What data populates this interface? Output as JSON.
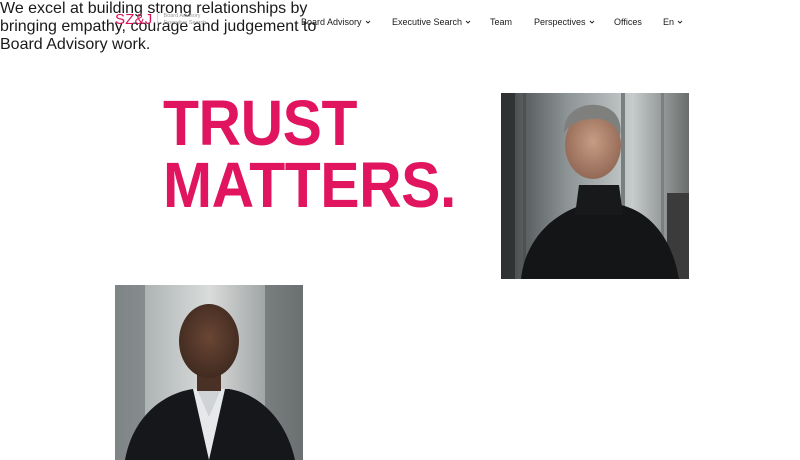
{
  "brand": {
    "logo_text": "SZ&J",
    "sub_line_1": "Board Advisory",
    "sub_line_2": "Executive Search",
    "accent_color": "#e0145f"
  },
  "nav": {
    "items": [
      {
        "label": "Board Advisory",
        "has_dropdown": true
      },
      {
        "label": "Executive Search",
        "has_dropdown": true
      },
      {
        "label": "Team",
        "has_dropdown": false
      },
      {
        "label": "Perspectives",
        "has_dropdown": true
      },
      {
        "label": "Offices",
        "has_dropdown": false
      },
      {
        "label": "En",
        "has_dropdown": true
      }
    ]
  },
  "hero": {
    "headline_line_1": "TRUST",
    "headline_line_2": "MATTERS.",
    "body_line_1": "We excel at building strong relationships by",
    "body_line_2": "bringing empathy, courage and judgement to",
    "body_line_3": "Board Advisory work."
  },
  "images": {
    "top_photo": "portrait-man-black-turtleneck",
    "bottom_photo": "portrait-man-dark-suit"
  }
}
